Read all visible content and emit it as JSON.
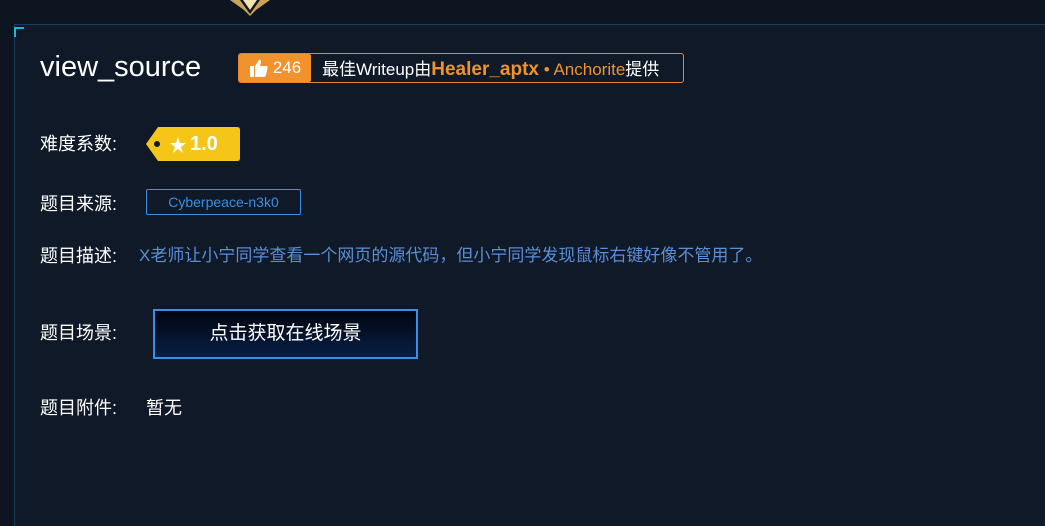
{
  "challenge": {
    "title": "view_source",
    "likes": "246",
    "writeup_prefix": "最佳Writeup由",
    "writeup_author": "Healer_aptx",
    "writeup_separator": " • ",
    "writeup_team": "Anchorite",
    "writeup_suffix": "提供"
  },
  "difficulty": {
    "label": "难度系数:",
    "value": "1.0"
  },
  "source": {
    "label": "题目来源:",
    "value": "Cyberpeace-n3k0"
  },
  "description": {
    "label": "题目描述:",
    "value": "X老师让小宁同学查看一个网页的源代码，但小宁同学发现鼠标右键好像不管用了。"
  },
  "scene": {
    "label": "题目场景:",
    "button": "点击获取在线场景"
  },
  "attachment": {
    "label": "题目附件:",
    "value": "暂无"
  },
  "colors": {
    "accent_orange": "#f0932d",
    "badge_yellow": "#f5c518",
    "link_blue": "#3d8fe0"
  },
  "icons": [
    "thumbs-up-icon",
    "star-icon",
    "emblem-icon"
  ]
}
